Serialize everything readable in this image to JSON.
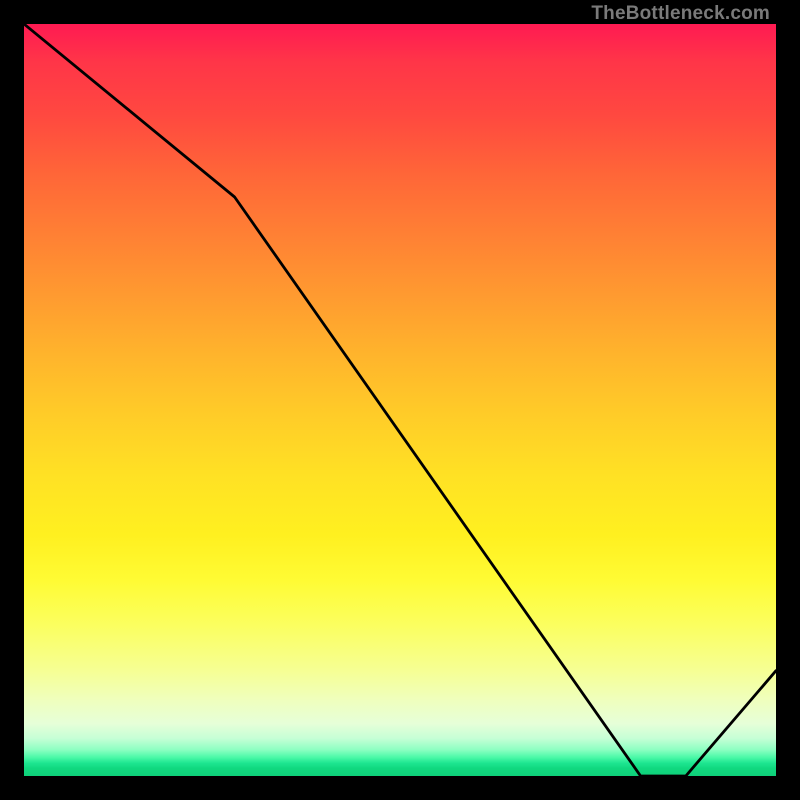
{
  "attribution": "TheBottleneck.com",
  "bottom_marker_text": "",
  "chart_data": {
    "type": "line",
    "title": "",
    "xlabel": "",
    "ylabel": "",
    "x": [
      0,
      0.28,
      0.82,
      0.88,
      1.0
    ],
    "values": [
      100,
      77,
      0,
      0,
      14
    ],
    "ylim": [
      0,
      100
    ],
    "xlim": [
      0,
      1
    ],
    "background_gradient": {
      "top_color": "#ff1a52",
      "mid_color": "#fff020",
      "bottom_color": "#10d87f"
    },
    "line_color": "#000000"
  }
}
